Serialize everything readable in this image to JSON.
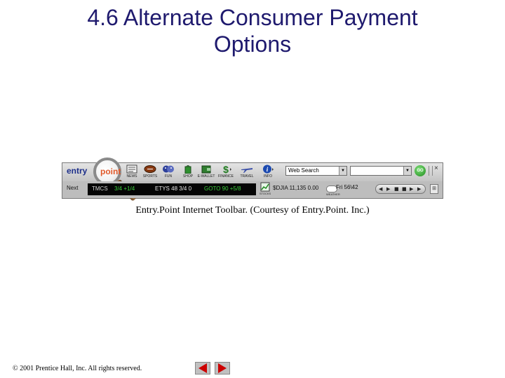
{
  "slide": {
    "title_line1": "4.6 Alternate Consumer Payment",
    "title_line2": "Options",
    "caption": "Entry.Point Internet Toolbar. (Courtesy of Entry.Point. Inc.)",
    "footer": "© 2001 Prentice Hall, Inc.  All rights reserved."
  },
  "toolbar": {
    "logo_text": "entry",
    "logo_accent": "point",
    "buttons": [
      {
        "label": "NEWS",
        "icon": "newspaper-icon"
      },
      {
        "label": "SPORTS",
        "icon": "football-icon"
      },
      {
        "label": "FUN",
        "icon": "masks-icon"
      },
      {
        "label": "SHOP",
        "icon": "shopping-bag-icon"
      },
      {
        "label": "E-WALLET",
        "icon": "wallet-icon"
      },
      {
        "label": "FINANCE",
        "icon": "dollar-icon"
      },
      {
        "label": "TRAVEL",
        "icon": "airplane-icon"
      },
      {
        "label": "INFO",
        "icon": "info-icon"
      }
    ],
    "search_engine": "Web Search",
    "search_value": "",
    "go_label": "GO",
    "close_label": "×",
    "next_label": "Next",
    "ticker": [
      {
        "text": "TMCS",
        "color": "#d8d8d8"
      },
      {
        "text": "3/4  +1/4",
        "color": "#3cd23c"
      },
      {
        "text": "ETYS  48 3/4  0",
        "color": "#e8e8e8"
      },
      {
        "text": "GOTO  90  +5/8",
        "color": "#3cd23c"
      }
    ],
    "stocks_label": "STOCKS",
    "dow_text": "$DJIA 11,135 0.00",
    "weather_label": "WEATHER",
    "weather_text": "Fri 56\\42",
    "media_controls": [
      "◀",
      "▶",
      "■",
      "■",
      "▶",
      "▶"
    ],
    "grid_label": "⊞"
  },
  "colors": {
    "title": "#1f1a6e",
    "nav_arrow": "#cc0000",
    "ticker_bg": "#050505"
  }
}
